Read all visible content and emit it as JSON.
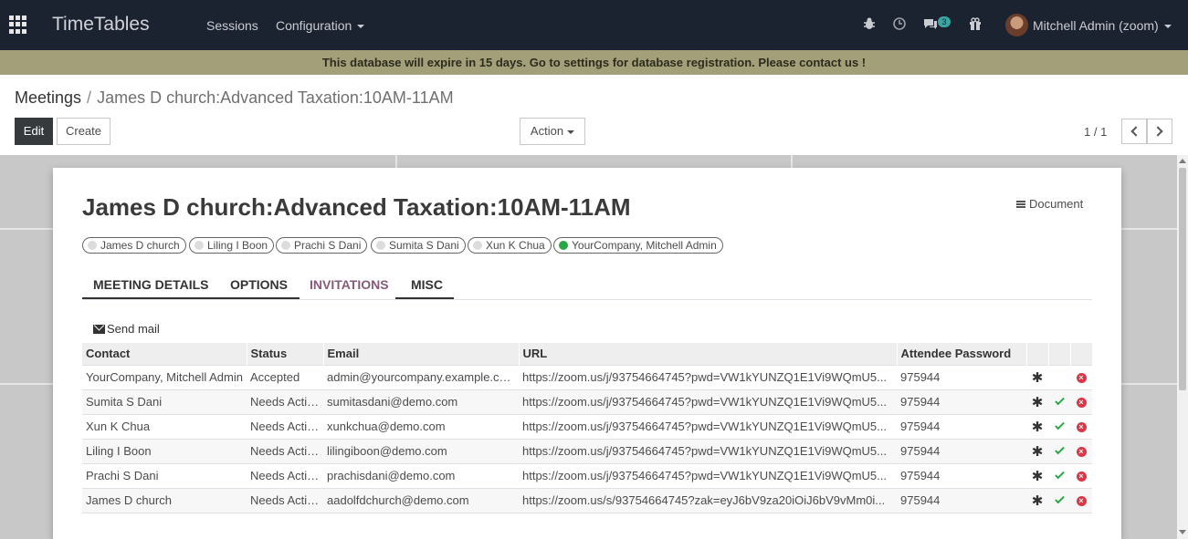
{
  "navbar": {
    "brand": "TimeTables",
    "menus": [
      "Sessions",
      "Configuration"
    ],
    "chat_badge": "3",
    "user": "Mitchell Admin (zoom)"
  },
  "banner": "This database will expire in 15 days. Go to settings for database registration. Please contact us !",
  "breadcrumb": {
    "parent": "Meetings",
    "current": "James D church:Advanced Taxation:10AM-11AM"
  },
  "buttons": {
    "edit": "Edit",
    "create": "Create",
    "action": "Action"
  },
  "pager": "1 / 1",
  "form": {
    "title": "James D church:Advanced Taxation:10AM-11AM",
    "document_label": "Document",
    "attendees": [
      {
        "name": "James D church",
        "online": false
      },
      {
        "name": "Liling I Boon",
        "online": false
      },
      {
        "name": "Prachi S Dani",
        "online": false
      },
      {
        "name": "Sumita S Dani",
        "online": false
      },
      {
        "name": "Xun K Chua",
        "online": false
      },
      {
        "name": "YourCompany, Mitchell Admin",
        "online": true
      }
    ],
    "tabs": [
      "MEETING DETAILS",
      "OPTIONS",
      "INVITATIONS",
      "MISC"
    ],
    "active_tab": "INVITATIONS",
    "send_mail": "Send mail"
  },
  "table": {
    "columns": [
      "Contact",
      "Status",
      "Email",
      "URL",
      "Attendee Password"
    ],
    "rows": [
      {
        "contact": "YourCompany, Mitchell Admin",
        "status": "Accepted",
        "email": "admin@yourcompany.example.com",
        "url": "https://zoom.us/j/93754664745?pwd=VW1kYUNZQ1E1Vi9WQmU5...",
        "password": "975944",
        "accept": false
      },
      {
        "contact": "Sumita S Dani",
        "status": "Needs Action",
        "email": "sumitasdani@demo.com",
        "url": "https://zoom.us/j/93754664745?pwd=VW1kYUNZQ1E1Vi9WQmU5...",
        "password": "975944",
        "accept": true
      },
      {
        "contact": "Xun K Chua",
        "status": "Needs Action",
        "email": "xunkchua@demo.com",
        "url": "https://zoom.us/j/93754664745?pwd=VW1kYUNZQ1E1Vi9WQmU5...",
        "password": "975944",
        "accept": true
      },
      {
        "contact": "Liling I Boon",
        "status": "Needs Action",
        "email": "lilingiboon@demo.com",
        "url": "https://zoom.us/j/93754664745?pwd=VW1kYUNZQ1E1Vi9WQmU5...",
        "password": "975944",
        "accept": true
      },
      {
        "contact": "Prachi S Dani",
        "status": "Needs Action",
        "email": "prachisdani@demo.com",
        "url": "https://zoom.us/j/93754664745?pwd=VW1kYUNZQ1E1Vi9WQmU5...",
        "password": "975944",
        "accept": true
      },
      {
        "contact": "James D church",
        "status": "Needs Action",
        "email": "aadolfdchurch@demo.com",
        "url": "https://zoom.us/s/93754664745?zak=eyJ6bV9za20iOiJ6bV9vMm0i...",
        "password": "975944",
        "accept": true
      }
    ]
  },
  "colors": {
    "navbar": "#1c2330",
    "banner": "#a39f78",
    "active_tab": "#875a7b",
    "accept": "#28a745",
    "decline": "#dc3545"
  }
}
